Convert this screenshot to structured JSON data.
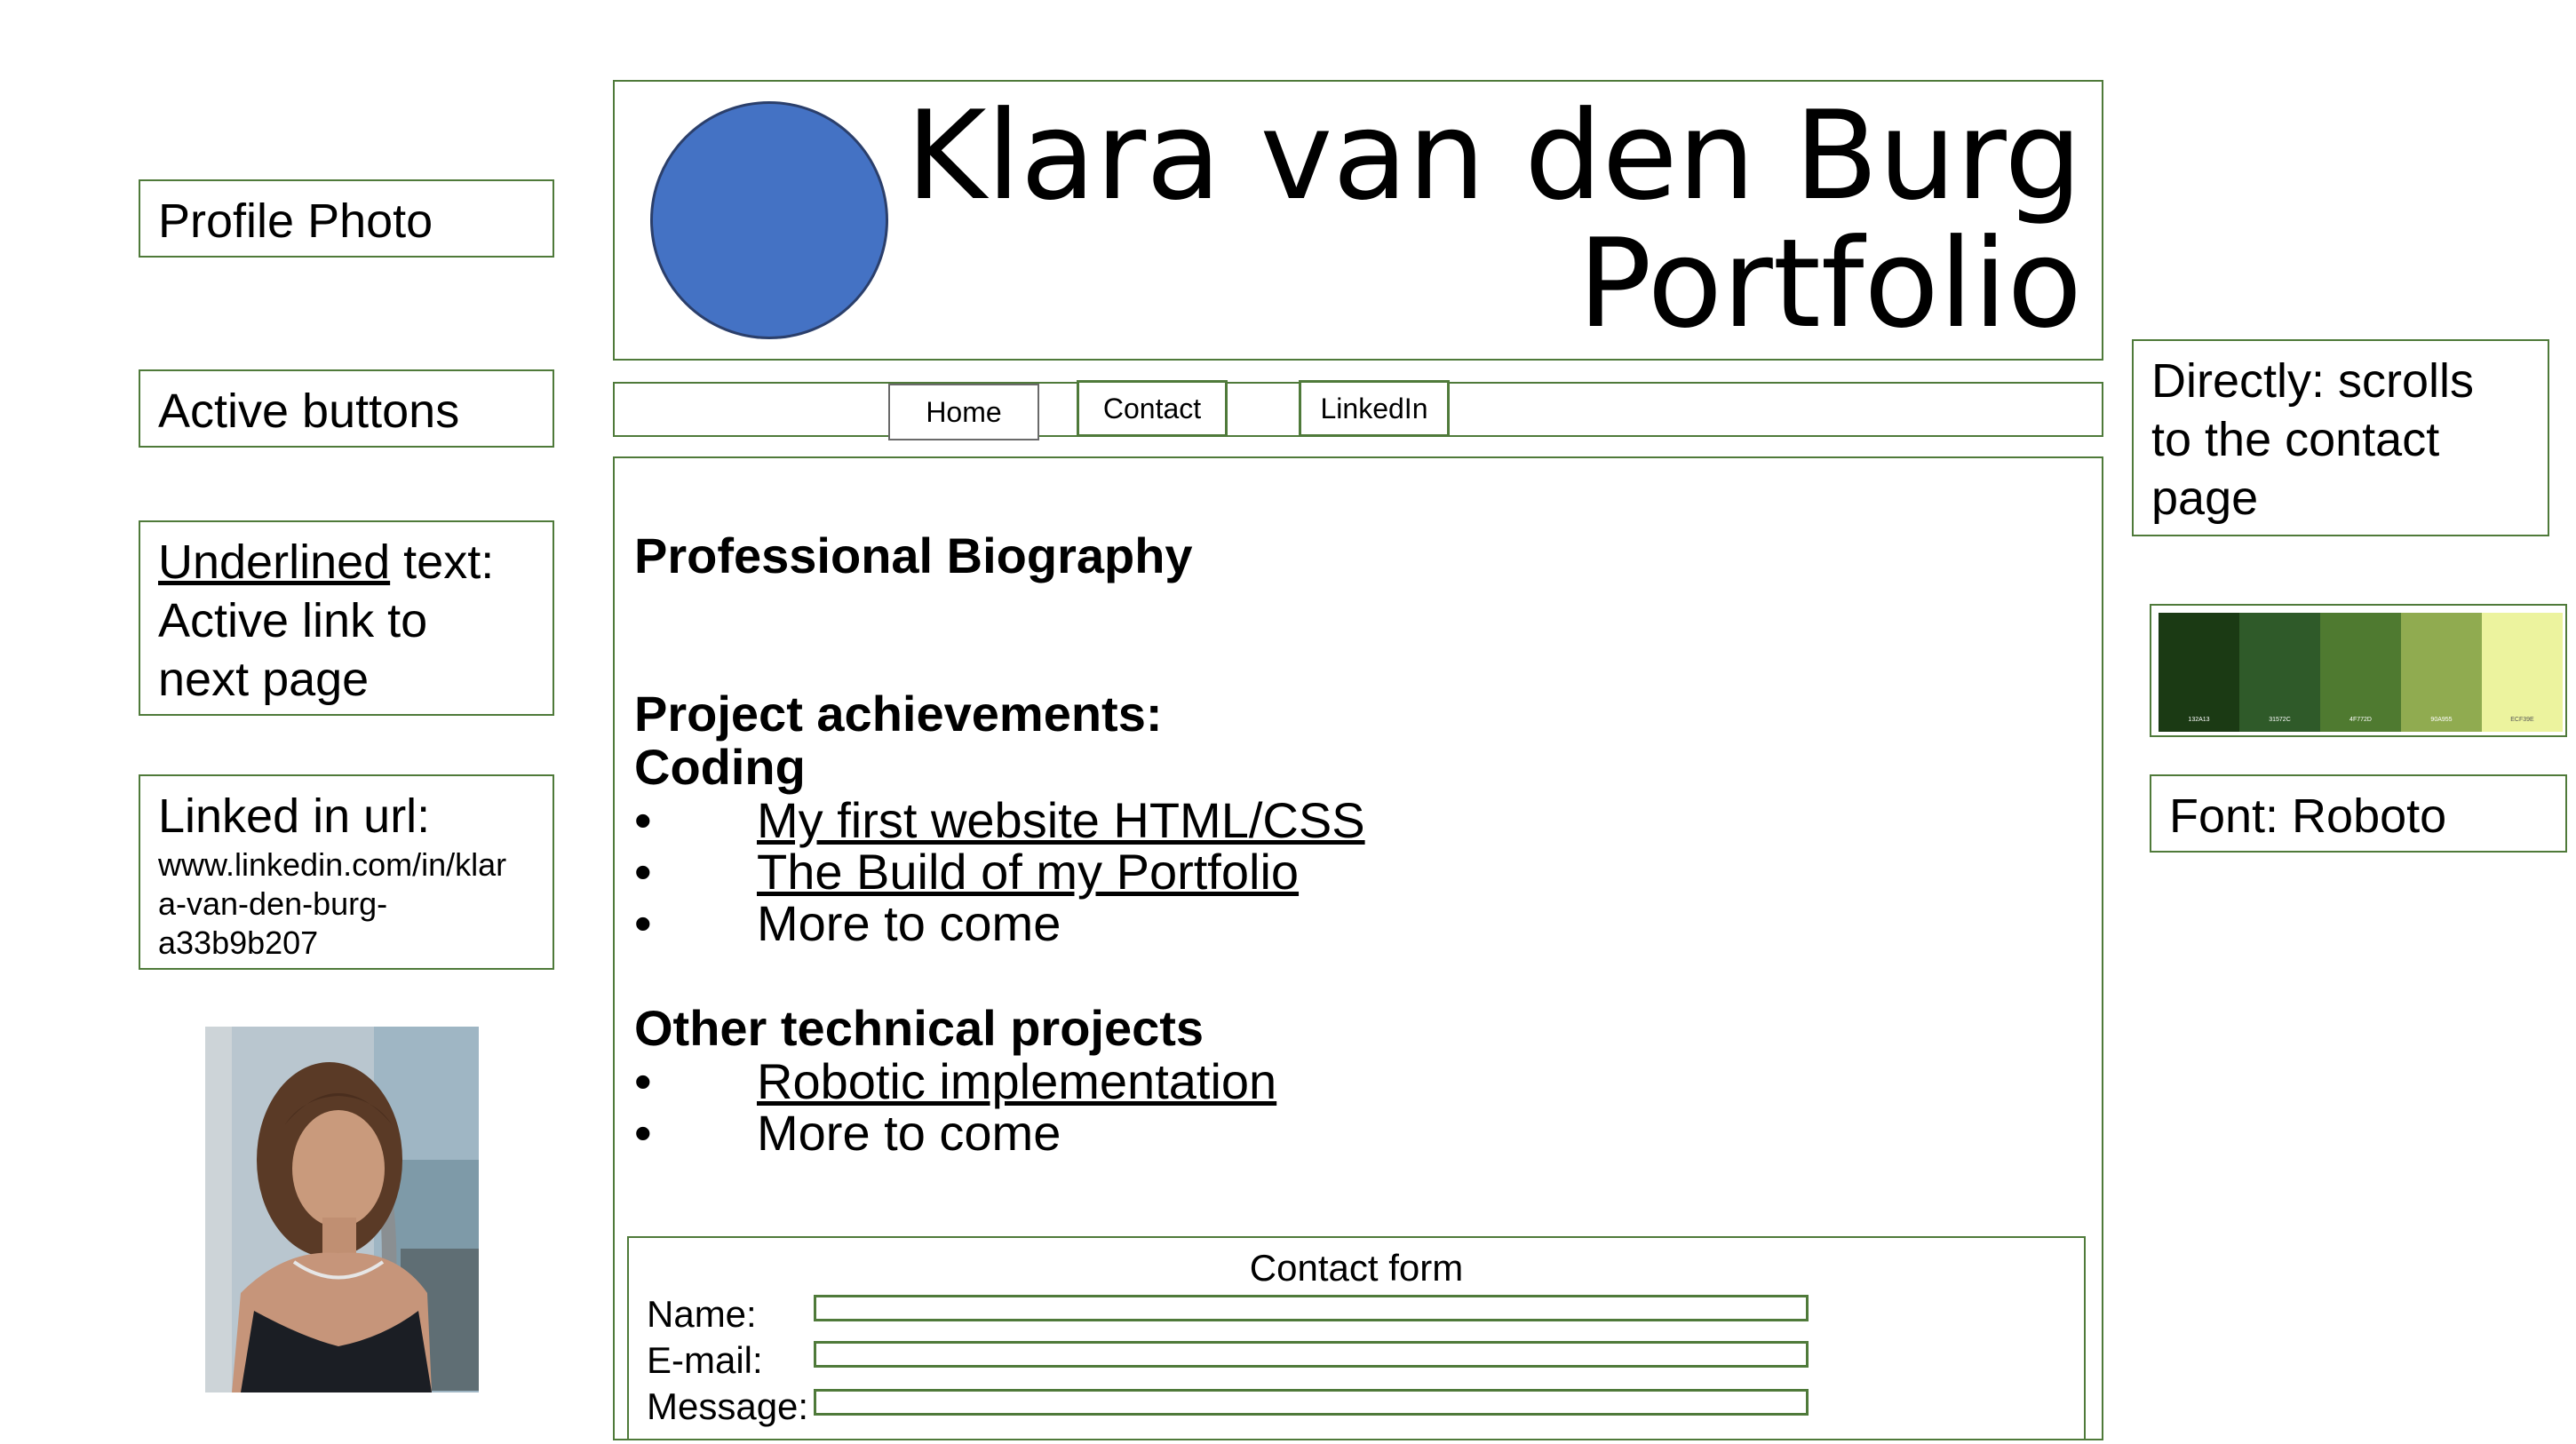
{
  "header": {
    "name": "Klara van den Burg",
    "subtitle": "Portfolio"
  },
  "nav": {
    "home": "Home",
    "contact": "Contact",
    "linkedin": "LinkedIn"
  },
  "main": {
    "biography_heading": "Professional Biography",
    "achievements_heading": "Project achievements:",
    "coding_heading": "Coding",
    "coding_items": [
      {
        "label": "My first website HTML/CSS",
        "link": true
      },
      {
        "label": "The Build of my Portfolio",
        "link": true
      },
      {
        "label": "More to come",
        "link": false
      }
    ],
    "other_heading": "Other technical projects",
    "other_items": [
      {
        "label": "Robotic implementation",
        "link": true
      },
      {
        "label": "More to come",
        "link": false
      }
    ],
    "bullet": "•"
  },
  "contact_form": {
    "title": "Contact form",
    "name_label": "Name:",
    "email_label": "E-mail:",
    "message_label": "Message:"
  },
  "notes": {
    "profile_photo": "Profile Photo",
    "active_buttons": "Active buttons",
    "underlined_word": "Underlined",
    "underlined_rest1": " text:",
    "underlined_rest2": "Active link to",
    "underlined_rest3": "next page",
    "linkedin_title": "Linked in url:",
    "linkedin_url_1": "www.linkedin.com/in/klar",
    "linkedin_url_2": "a-van-den-burg-",
    "linkedin_url_3": "a33b9b207",
    "scrolls_1": "Directly: scrolls",
    "scrolls_2": "to the contact",
    "scrolls_3": "page",
    "font_note": "Font: Roboto"
  },
  "palette": {
    "colors": [
      "#1b3a14",
      "#2f5a29",
      "#4f7a30",
      "#90ab50",
      "#ecf39e"
    ],
    "codes": [
      "132A13",
      "31572C",
      "4F772D",
      "90A955",
      "ECF39E"
    ]
  },
  "colors": {
    "border": "#4f7a3a",
    "avatar": "#4472c4"
  }
}
